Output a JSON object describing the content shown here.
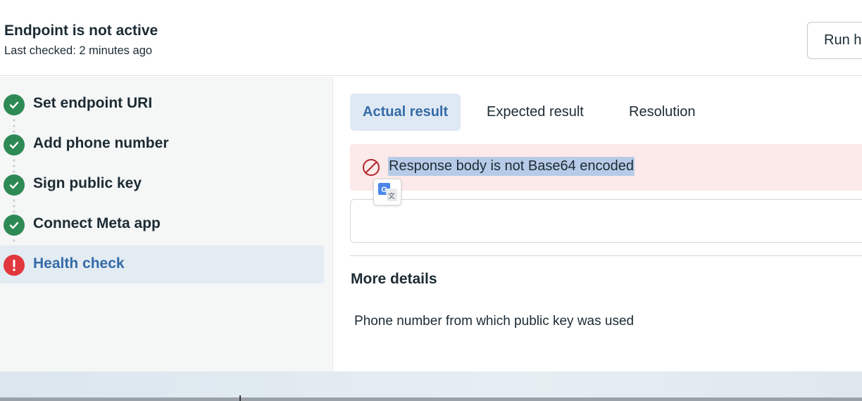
{
  "header": {
    "title": "Endpoint is not active",
    "subtitle": "Last checked: 2 minutes ago",
    "run_button_label": "Run health check"
  },
  "steps": [
    {
      "label": "Set endpoint URI",
      "status": "complete",
      "icon": "check-circle-icon"
    },
    {
      "label": "Add phone number",
      "status": "complete",
      "icon": "check-circle-icon"
    },
    {
      "label": "Sign public key",
      "status": "complete",
      "icon": "check-circle-icon"
    },
    {
      "label": "Connect Meta app",
      "status": "complete",
      "icon": "check-circle-icon"
    },
    {
      "label": "Health check",
      "status": "error",
      "icon": "exclamation-circle-icon",
      "selected": true
    }
  ],
  "tabs": [
    {
      "label": "Actual result",
      "active": true
    },
    {
      "label": "Expected result",
      "active": false
    },
    {
      "label": "Resolution",
      "active": false
    }
  ],
  "alert": {
    "icon": "prohibited-icon",
    "message": "Response body is not Base64 encoded"
  },
  "translate_badge": {
    "icon": "google-translate-icon"
  },
  "more_details": {
    "title": "More details",
    "text": "Phone number from which public key was used"
  },
  "colors": {
    "success": "#2e8a55",
    "error": "#e0383e",
    "accent": "#346ba7",
    "active_tab_bg": "#dfe9f4",
    "alert_bg": "#fce9e9",
    "selection_highlight": "#b7cbe8"
  }
}
